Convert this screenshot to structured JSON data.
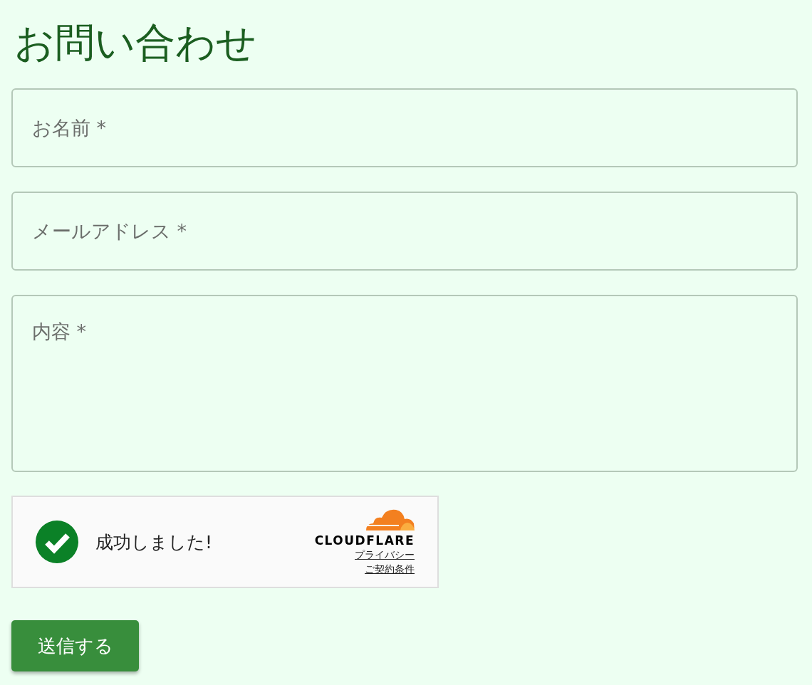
{
  "title": "お問い合わせ",
  "fields": [
    {
      "kind": "input",
      "placeholder": "お名前 *"
    },
    {
      "kind": "input",
      "placeholder": "メールアドレス *"
    },
    {
      "kind": "textarea",
      "placeholder": "内容 *"
    }
  ],
  "captcha": {
    "verified": true,
    "message": "成功しました!",
    "brand": "CLOUDFLARE",
    "links": [
      "プライバシー",
      "ご契約条件"
    ]
  },
  "submit": "送信する"
}
